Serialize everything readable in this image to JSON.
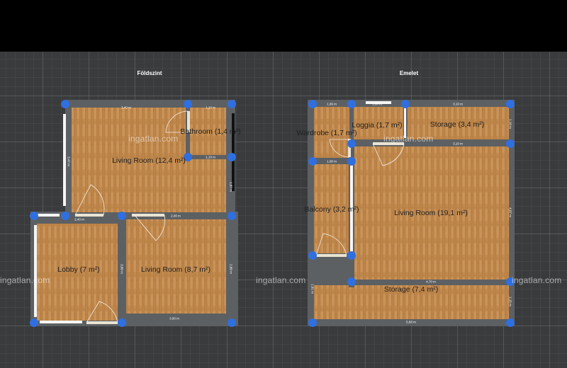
{
  "floors": [
    {
      "title": "Földszint",
      "rooms": [
        {
          "label": "Bathroom (1,4 m²)"
        },
        {
          "label": "Living Room (12,4 m²)"
        },
        {
          "label": "Lobby (7 m²)"
        },
        {
          "label": "Living Room (8,7 m²)"
        }
      ],
      "dimensions": [
        "3,40 m",
        "1,10 m",
        "1,10 m",
        "2,40 m",
        "2,00 m",
        "3,00 m",
        "2,80 m",
        "1,87 m",
        "3,47 m",
        "3,80 m"
      ]
    },
    {
      "title": "Emelet",
      "rooms": [
        {
          "label": "Wardrobe (1,7 m²)"
        },
        {
          "label": "Loggia (1,7 m²)"
        },
        {
          "label": "Storage (3,4 m²)"
        },
        {
          "label": "Balcony (3,2 m²)"
        },
        {
          "label": "Living Room (19,1 m²)"
        },
        {
          "label": "Storage (7,4 m²)"
        }
      ],
      "dimensions": [
        "1,06 m",
        "1,00 m",
        "3,10 m",
        "3,10 m",
        "1,08 m",
        "4,70 m",
        "5,68 m",
        "4,07 m",
        "1,10 m",
        "1,15 m",
        "1,81 m"
      ]
    }
  ],
  "watermark": "ingatlan.com",
  "colors": {
    "background": "#3a3b3d",
    "wall": "#5d6063",
    "floor": "#c0894f",
    "corner_handle": "#2f6fe0",
    "door": "#e9e3d3"
  }
}
